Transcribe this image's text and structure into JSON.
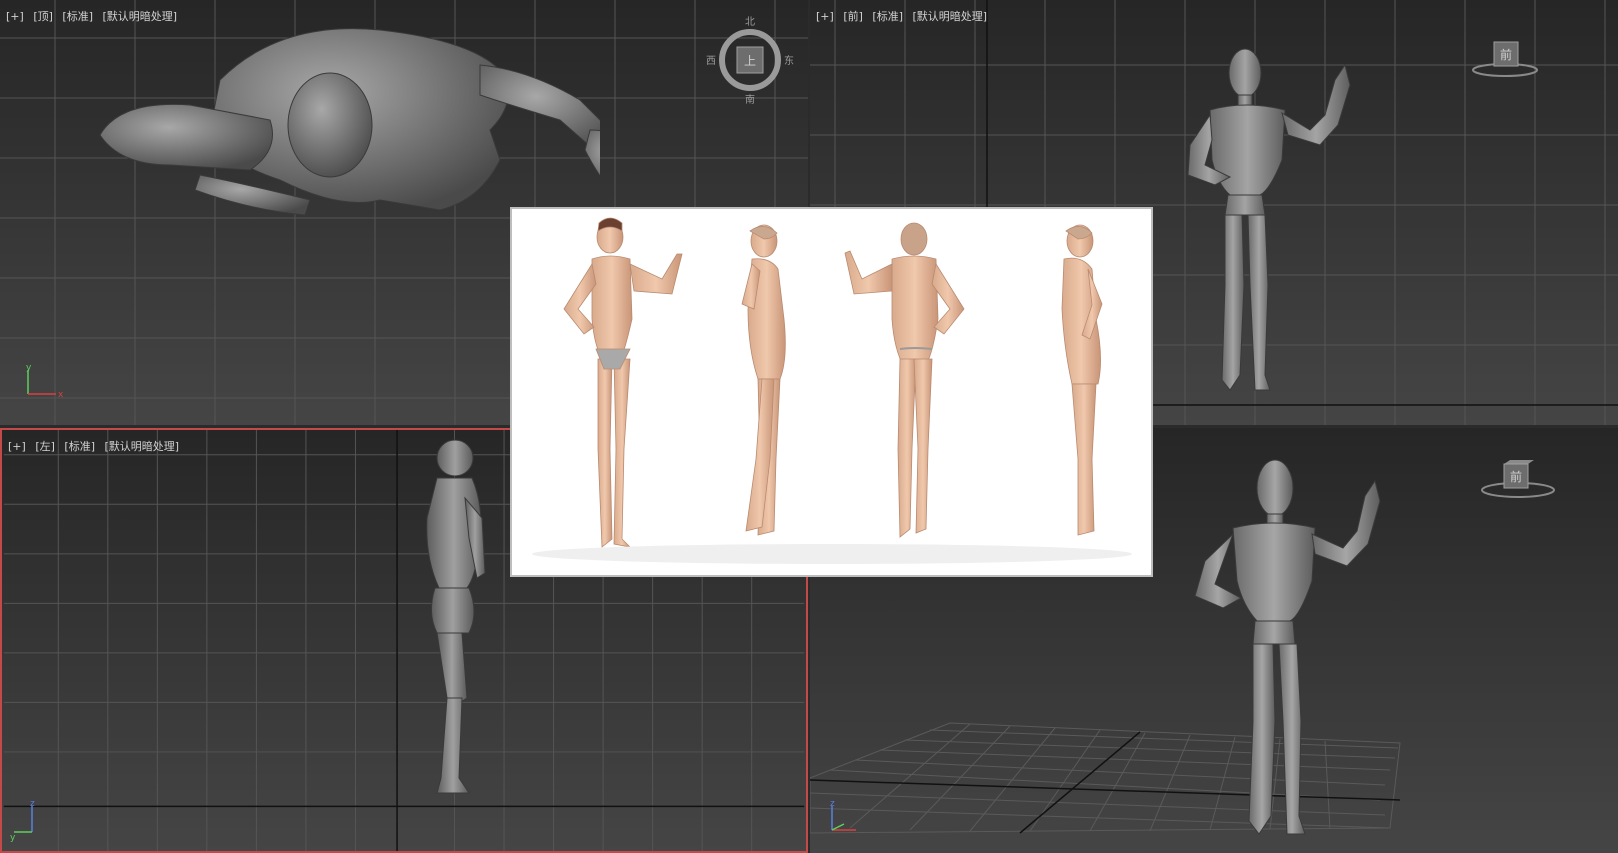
{
  "viewports": {
    "top": {
      "plus": "[+]",
      "view": "[顶]",
      "shading": "[标准]",
      "lighting": "[默认明暗处理]"
    },
    "front": {
      "plus": "[+]",
      "view": "[前]",
      "shading": "[标准]",
      "lighting": "[默认明暗处理]"
    },
    "left": {
      "plus": "[+]",
      "view": "[左]",
      "shading": "[标准]",
      "lighting": "[默认明暗处理]"
    },
    "perspective": {}
  },
  "viewcube": {
    "top": {
      "face": "上",
      "north": "北",
      "south": "南",
      "east": "东",
      "west": "西"
    },
    "front": {
      "face": "前"
    },
    "perspective": {
      "face": "前"
    }
  },
  "axes": {
    "x": "x",
    "y": "y",
    "z": "z"
  },
  "colors": {
    "active_border": "#c44a4a",
    "axis_x": "#d94040",
    "axis_y": "#5fcf5f",
    "axis_z": "#5a7fe0",
    "grid": "#5a5a5a",
    "mannequin": "#8c8c8c"
  }
}
